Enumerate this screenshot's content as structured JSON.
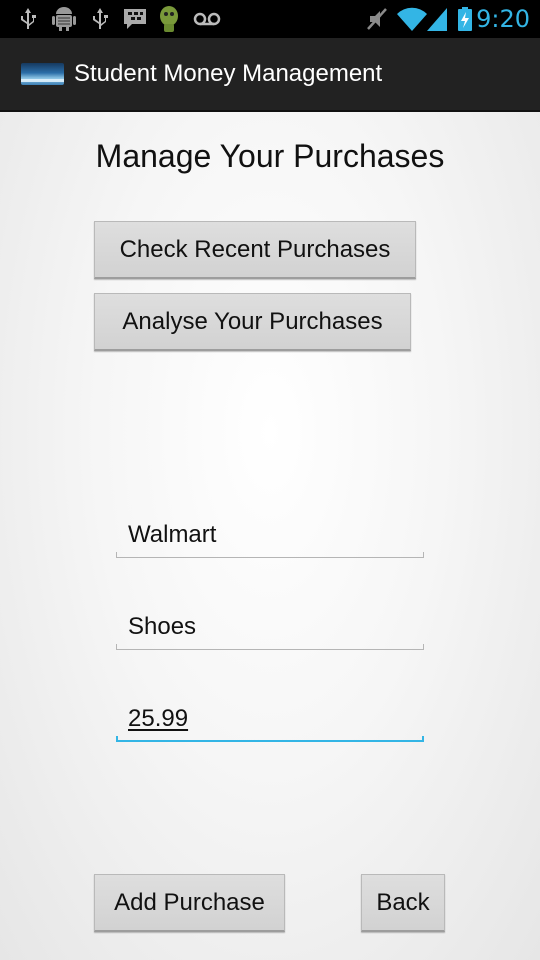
{
  "status_bar": {
    "time": "9:20",
    "left_icons": [
      "usb-icon",
      "android-debug-icon",
      "usb-icon",
      "bbm-icon",
      "android-app-icon",
      "voicemail-icon"
    ],
    "right_icons": [
      "muted-icon",
      "wifi-icon",
      "signal-icon",
      "battery-charging-icon"
    ],
    "accent_color": "#33b5e5"
  },
  "action_bar": {
    "title": "Student Money Management",
    "icon": "app-landscape-icon",
    "background": "#222222"
  },
  "main": {
    "heading": "Manage Your Purchases",
    "check_recent_label": "Check Recent Purchases",
    "analyse_label": "Analyse Your Purchases",
    "fields": {
      "store": "Walmart",
      "item": "Shoes",
      "price": "25.99"
    },
    "add_purchase_label": "Add Purchase",
    "back_label": "Back"
  }
}
